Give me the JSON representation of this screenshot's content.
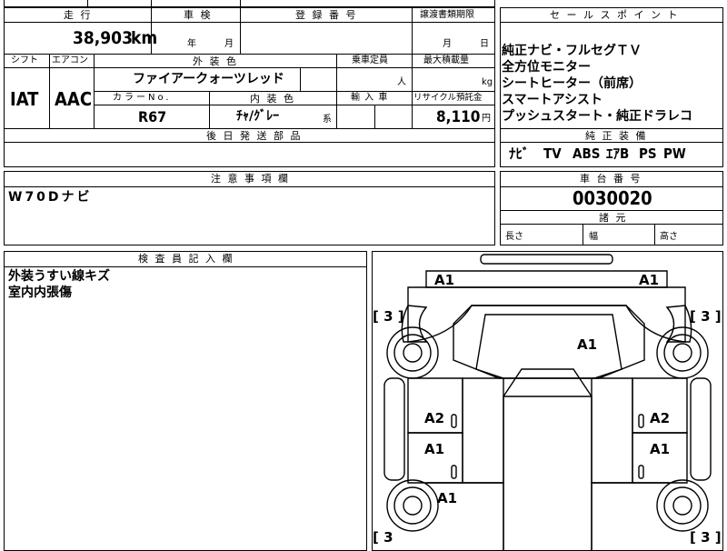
{
  "sheet": {
    "mileage_header": "走 行",
    "mileage_value": "38,903",
    "mileage_unit": "km",
    "inspection_header": "車 検",
    "inspection_year": "年",
    "inspection_month": "月",
    "registration_header": "登 録 番 号",
    "transfer_header": "譲渡書類期限",
    "transfer_month": "月",
    "transfer_day": "日",
    "shift_header": "シフト",
    "ac_header": "エアコン",
    "exterior_header": "外 装 色",
    "capacity_header": "乗車定員",
    "max_load_header": "最大積載量",
    "shift_value": "IAT",
    "ac_value": "AAC",
    "exterior_value": "ファイアークォーツレッド",
    "capacity_unit": "人",
    "max_load_unit": "kg",
    "color_no_header": "カラーNo.",
    "interior_header": "内 装 色",
    "import_header": "輸 入 車",
    "recycle_header": "リサイクル預託金",
    "color_no_value": "R67",
    "interior_value": "ﾁｬ/ｸﾞﾚｰ",
    "interior_suffix": "系",
    "recycle_value": "8,110",
    "recycle_unit": "円",
    "later_parts_header": "後 日 発 送 部 品",
    "notes_header": "注 意 事 項 欄",
    "notes_value": "W70Dナビ",
    "inspector_header": "検 査 員 記 入 欄",
    "inspector_notes": [
      "外装うすい線キズ",
      "室内内張傷"
    ]
  },
  "sales": {
    "header": "セ ー ル ス ポ イ ン ト",
    "points": [
      "純正ナビ・フルセグＴＶ",
      "全方位モニター",
      "シートヒーター（前席）",
      "スマートアシスト",
      "プッシュスタート・純正ドラレコ"
    ],
    "equipment_header": "純 正 装 備",
    "equipment": [
      "ﾅﾋﾞ",
      "TV",
      "ABS",
      "ｴｱB",
      "PS",
      "PW"
    ]
  },
  "chassis": {
    "number_header": "車 台 番 号",
    "number_value": "0030020",
    "dims_header": "諸 元",
    "length_label": "長さ",
    "width_label": "幅",
    "height_label": "高さ"
  },
  "diagram": {
    "marks": {
      "front_left": "A1",
      "front_right": "A1",
      "roof": "A1",
      "door_left_1": "A2",
      "door_right_1": "A2",
      "door_left_2": "A1",
      "door_right_2": "A1",
      "rear_left": "A1"
    },
    "brackets": {
      "top_left": "[ 3 ]",
      "top_right": "[ 3 ]",
      "bottom_left": "[ 3",
      "bottom_right": "[ 3 ]"
    }
  }
}
